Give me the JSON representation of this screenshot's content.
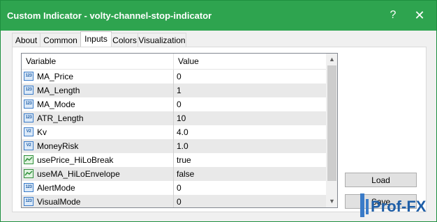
{
  "window": {
    "title": "Custom Indicator - volty-channel-stop-indicator",
    "help": "?",
    "close": "✕"
  },
  "tabs": [
    {
      "label": "About"
    },
    {
      "label": "Common"
    },
    {
      "label": "Inputs",
      "active": true
    },
    {
      "label": "Colors"
    },
    {
      "label": "Visualization"
    }
  ],
  "grid": {
    "columns": {
      "variable": "Variable",
      "value": "Value"
    },
    "rows": [
      {
        "icon": "123",
        "name": "MA_Price",
        "value": "0"
      },
      {
        "icon": "123",
        "name": "MA_Length",
        "value": "1"
      },
      {
        "icon": "123",
        "name": "MA_Mode",
        "value": "0"
      },
      {
        "icon": "123",
        "name": "ATR_Length",
        "value": "10"
      },
      {
        "icon": "V2",
        "name": "Kv",
        "value": "4.0"
      },
      {
        "icon": "V2",
        "name": "MoneyRisk",
        "value": "1.0"
      },
      {
        "icon": "bool",
        "name": "usePrice_HiLoBreak",
        "value": "true"
      },
      {
        "icon": "bool",
        "name": "useMA_HiLoEnvelope",
        "value": "false"
      },
      {
        "icon": "123",
        "name": "AlertMode",
        "value": "0"
      },
      {
        "icon": "123",
        "name": "VisualMode",
        "value": "0"
      }
    ]
  },
  "buttons": {
    "load": "Load",
    "save": "Save"
  },
  "watermark": {
    "text": "Prof-FX"
  },
  "colors": {
    "titlebar": "#2ea44f",
    "accent": "#3a7bc8"
  }
}
